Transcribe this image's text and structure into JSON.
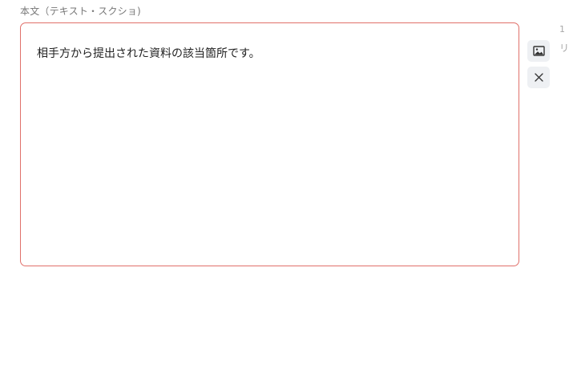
{
  "field": {
    "label": "本文（テキスト・スクショ)",
    "value": "相手方から提出された資料の該当箇所です。"
  },
  "side_actions": {
    "image_icon": "image-icon",
    "close_icon": "close-icon"
  },
  "edge": {
    "number": "1",
    "partial_text": "リ"
  },
  "colors": {
    "border_error": "#e0706a",
    "button_bg": "#eef0f3",
    "icon": "#333333"
  }
}
